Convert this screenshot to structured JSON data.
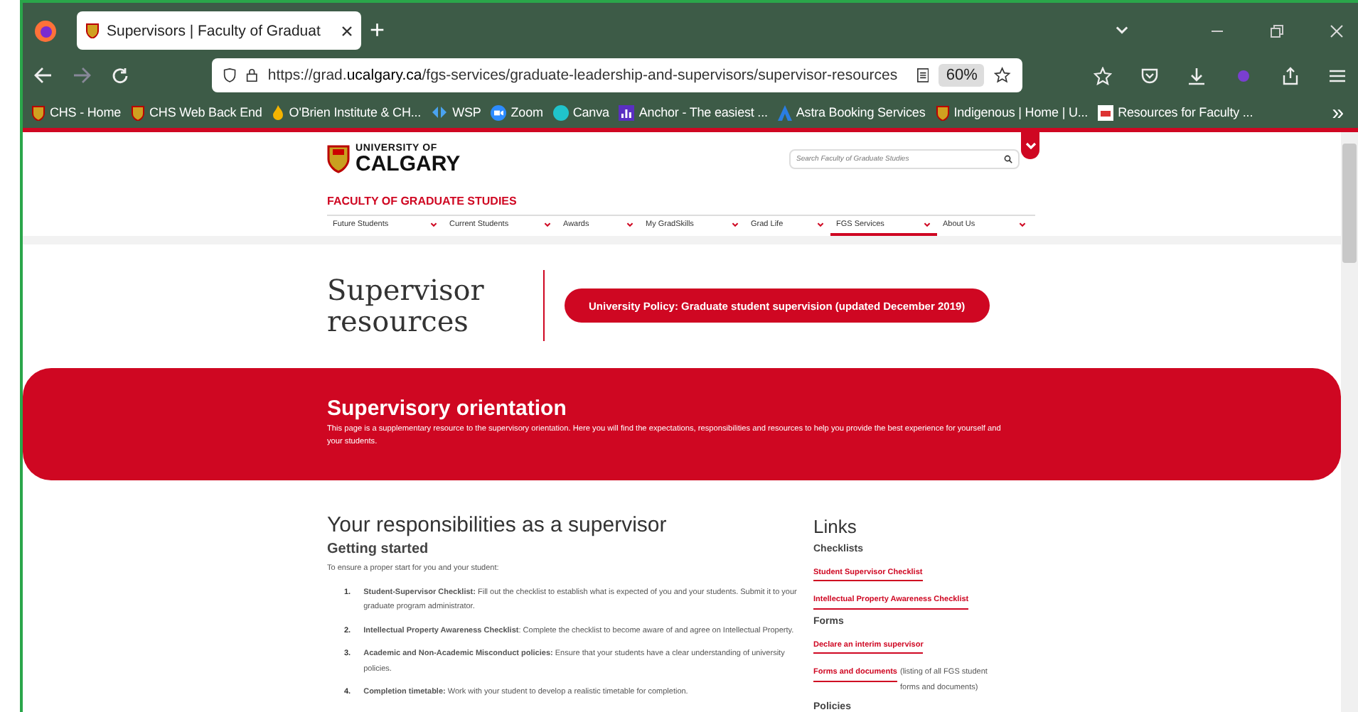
{
  "browser": {
    "tab_title": "Supervisors | Faculty of Graduat",
    "new_tab": "+",
    "url_host": "grad.",
    "url_domain": "ucalgary.ca",
    "url_path": "/fgs-services/graduate-leadership-and-supervisors/supervisor-resources",
    "url_scheme": "https://",
    "zoom": "60%",
    "bookmarks": [
      {
        "label": "CHS - Home",
        "kind": "shield"
      },
      {
        "label": "CHS Web Back End",
        "kind": "shield"
      },
      {
        "label": "O'Brien Institute & CH...",
        "kind": "flame"
      },
      {
        "label": "WSP",
        "kind": "wsp"
      },
      {
        "label": "Zoom",
        "kind": "zoom"
      },
      {
        "label": "Canva",
        "kind": "canva"
      },
      {
        "label": "Anchor - The easiest ...",
        "kind": "anchor"
      },
      {
        "label": "Astra Booking Services",
        "kind": "astra"
      },
      {
        "label": "Indigenous | Home | U...",
        "kind": "shield"
      },
      {
        "label": "Resources for Faculty ...",
        "kind": "doc"
      }
    ],
    "overflow": "»"
  },
  "header": {
    "logo_top": "UNIVERSITY OF",
    "logo_bottom": "CALGARY",
    "search_placeholder": "Search Faculty of Graduate Studies",
    "faculty": "FACULTY OF GRADUATE STUDIES",
    "nav": [
      {
        "label": "Future Students",
        "selected": false
      },
      {
        "label": "Current Students",
        "selected": false
      },
      {
        "label": "Awards",
        "selected": false
      },
      {
        "label": "My GradSkills",
        "selected": false
      },
      {
        "label": "Grad Life",
        "selected": false
      },
      {
        "label": "FGS Services",
        "selected": true
      },
      {
        "label": "About Us",
        "selected": false
      }
    ]
  },
  "hero": {
    "title": "Supervisor resources",
    "policy_button": "University Policy: Graduate student supervision (updated December 2019)"
  },
  "banner": {
    "title": "Supervisory orientation",
    "text": "This page is a supplementary resource to the supervisory orientation. Here you will find the expectations, responsibilities and resources to help you provide the best experience for yourself and your students."
  },
  "main": {
    "heading": "Your responsibilities as a supervisor",
    "subheading": "Getting started",
    "intro": "To ensure a proper start for you and your student:",
    "steps": [
      {
        "number": "1.",
        "text": "**Student-Supervisor Checklist:** Fill out the checklist to establish what is expected of you and your students. Submit it to your graduate program administrator."
      },
      {
        "number": "2.",
        "text": "**Intellectual Property Awareness Checklist**: Complete the checklist to become aware of and agree on Intellectual Property."
      },
      {
        "number": "3.",
        "text": "**Academic and Non-Academic Misconduct policies:** Ensure that your students have a clear understanding of university policies."
      },
      {
        "number": "4.",
        "text": "**Completion timetable:** Work with your student to develop a realistic timetable for completion."
      }
    ]
  },
  "links": {
    "heading": "Links",
    "groups": [
      {
        "title": "Checklists",
        "items": [
          {
            "link": "Student Supervisor Checklist"
          },
          {
            "link": "Intellectual Property Awareness Checklist"
          }
        ]
      },
      {
        "title": "Forms",
        "items": [
          {
            "link": "Declare an interim supervisor"
          },
          {
            "link": "Forms and documents",
            "note": "(listing of all FGS student forms and documents)"
          }
        ]
      },
      {
        "title": "Policies"
      }
    ]
  }
}
